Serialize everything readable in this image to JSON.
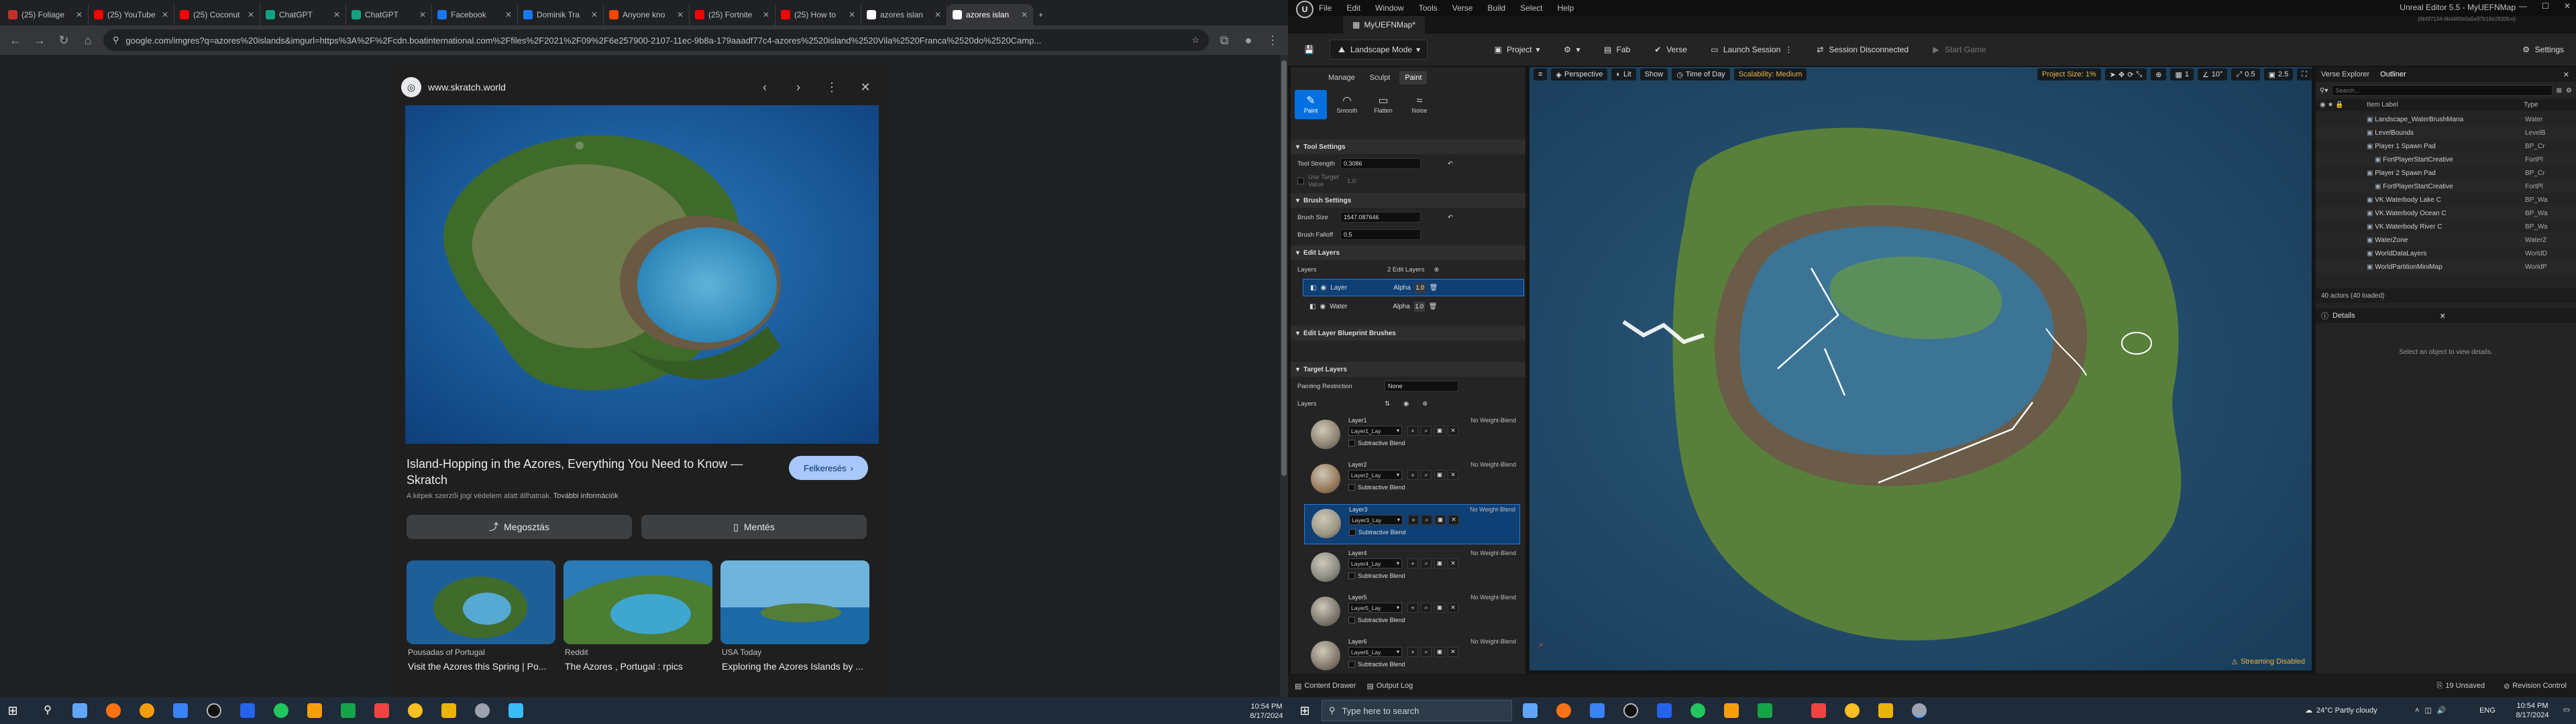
{
  "browser": {
    "tabs": [
      {
        "label": "(25) Foliage",
        "color": "#c4302b"
      },
      {
        "label": "(25) YouTube",
        "color": "#ff0000"
      },
      {
        "label": "(25) Coconut",
        "color": "#ff0000"
      },
      {
        "label": "ChatGPT",
        "color": "#10a37f"
      },
      {
        "label": "ChatGPT",
        "color": "#10a37f"
      },
      {
        "label": "Facebook",
        "color": "#1877f2"
      },
      {
        "label": "Dominik Tra",
        "color": "#1877f2"
      },
      {
        "label": "Anyone kno",
        "color": "#ff4500"
      },
      {
        "label": "(25) Fortnite",
        "color": "#ff0000"
      },
      {
        "label": "(25) How to",
        "color": "#ff0000"
      },
      {
        "label": "azores islan",
        "color": "#ffffff"
      },
      {
        "label": "azores islan",
        "color": "#ffffff"
      }
    ],
    "url": "google.com/imgres?q=azores%20islands&imgurl=https%3A%2F%2Fcdn.boatinternational.com%2Ffiles%2F2021%2F09%2F6e257900-2107-11ec-9b8a-179aaadf77c4-azores%2520island%2520Vila%2520Franca%2520do%2520Camp..."
  },
  "image_panel": {
    "site_name": "www.skratch.world",
    "title": "Island-Hopping in the Azores, Everything You Need to Know — Skratch",
    "search_btn": "Felkeresés",
    "copyright": "A képek szerzői jogi védelem alatt állhatnak.",
    "more_info": "További információk",
    "share_btn": "Megosztás",
    "save_btn": "Mentés",
    "thumbs": [
      {
        "source": "Pousadas of Portugal",
        "caption": "Visit the Azores this Spring | Po..."
      },
      {
        "source": "Reddit",
        "caption": "The Azores , Portugal : rpics"
      },
      {
        "source": "USA Today",
        "caption": "Exploring the Azores Islands by ..."
      }
    ]
  },
  "left_clock": {
    "time": "10:54 PM",
    "date": "8/17/2024"
  },
  "ue": {
    "menu": [
      "File",
      "Edit",
      "Window",
      "Tools",
      "Verse",
      "Build",
      "Select",
      "Help"
    ],
    "app_title": "Unreal Editor 5.5 - MyUEFNMap",
    "app_sub": "{6b5f7134-6b4480e0a5e97b16e2930fce}",
    "map_tab": "MyUEFNMap*",
    "toolbar": {
      "mode": "Landscape Mode",
      "project": "Project",
      "fab": "Fab",
      "verse": "Verse",
      "launch": "Launch Session",
      "session": "Session Disconnected",
      "start": "Start Game",
      "settings": "Settings"
    },
    "mode_tabs": [
      "Manage",
      "Sculpt",
      "Paint"
    ],
    "tools": [
      "Paint",
      "Smooth",
      "Flatten",
      "Noise"
    ],
    "tool_settings": {
      "header": "Tool Settings",
      "strength_label": "Tool Strength",
      "strength_value": "0.3086",
      "target_label": "Use Target Value",
      "target_value": "1.0"
    },
    "brush_settings": {
      "header": "Brush Settings",
      "size_label": "Brush Size",
      "size_value": "1547.087646",
      "falloff_label": "Brush Falloff",
      "falloff_value": "0.5"
    },
    "edit_layers": {
      "header": "Edit Layers",
      "layers_label": "Layers",
      "count": "2 Edit Layers",
      "rows": [
        {
          "name": "Layer",
          "blend": "Alpha",
          "alpha": "1.0"
        },
        {
          "name": "Water",
          "blend": "Alpha",
          "alpha": "1.0"
        }
      ]
    },
    "bp_brushes": "Edit Layer Blueprint Brushes",
    "target_layers": {
      "header": "Target Layers",
      "restriction_label": "Painting Restriction",
      "restriction_value": "None",
      "layers_label": "Layers"
    },
    "paint_layers": [
      {
        "name": "Layer1",
        "asset": "Layer1_Lay",
        "nw": "No Weight-Blend",
        "sub": "Subtractive Blend",
        "color": "#8c8271"
      },
      {
        "name": "Layer2",
        "asset": "Layer2_Lay",
        "nw": "No Weight-Blend",
        "sub": "Subtractive Blend",
        "color": "#96795a"
      },
      {
        "name": "Layer3",
        "asset": "Layer3_Lay",
        "nw": "No Weight-Blend",
        "sub": "Subtractive Blend",
        "color": "#9c9585"
      },
      {
        "name": "Layer4",
        "asset": "Layer4_Lay",
        "nw": "No Weight-Blend",
        "sub": "Subtractive Blend",
        "color": "#8a8a82"
      },
      {
        "name": "Layer5",
        "asset": "Layer5_Lay",
        "nw": "No Weight-Blend",
        "sub": "Subtractive Blend",
        "color": "#7c776e"
      },
      {
        "name": "Layer6",
        "asset": "Layer6_Lay",
        "nw": "No Weight-Blend",
        "sub": "Subtractive Blend",
        "color": "#837a6c"
      }
    ],
    "viewport": {
      "perspective": "Perspective",
      "lit": "Lit",
      "show": "Show",
      "time": "Time of Day",
      "scalability": "Scalability: Medium",
      "project_size": "Project Size: 1%",
      "grid": "1",
      "angle": "10°",
      "scale": "0.5",
      "cam": "2.5",
      "streaming": "Streaming Disabled"
    },
    "outliner": {
      "tabs": [
        "Verse Explorer",
        "Outliner"
      ],
      "search_placeholder": "Search...",
      "col_label": "Item Label",
      "col_type": "Type",
      "rows": [
        {
          "name": "Landscape_WaterBrushMana",
          "type": "Water",
          "indent": 0
        },
        {
          "name": "LevelBounds",
          "type": "LevelB",
          "indent": 0
        },
        {
          "name": "Player 1 Spawn Pad",
          "type": "BP_Cr",
          "indent": 0
        },
        {
          "name": "FortPlayerStartCreative",
          "type": "FortPl",
          "indent": 1
        },
        {
          "name": "Player 2 Spawn Pad",
          "type": "BP_Cr",
          "indent": 0
        },
        {
          "name": "FortPlayerStartCreative",
          "type": "FortPl",
          "indent": 1
        },
        {
          "name": "VK.Waterbody Lake C",
          "type": "BP_Wa",
          "indent": 0
        },
        {
          "name": "VK.Waterbody Ocean C",
          "type": "BP_Wa",
          "indent": 0
        },
        {
          "name": "VK.Waterbody River C",
          "type": "BP_Wa",
          "indent": 0
        },
        {
          "name": "WaterZone",
          "type": "WaterZ",
          "indent": 0
        },
        {
          "name": "WorldDataLayers",
          "type": "WorldD",
          "indent": 0
        },
        {
          "name": "WorldPartitionMiniMap",
          "type": "WorldP",
          "indent": 0
        }
      ],
      "count": "40 actors (40 loaded)"
    },
    "details": {
      "tab": "Details",
      "empty": "Select an object to view details."
    },
    "status": {
      "content_drawer": "Content Drawer",
      "output_log": "Output Log",
      "unsaved": "19 Unsaved",
      "revision": "Revision Control"
    }
  },
  "taskbar": {
    "search_placeholder": "Type here to search",
    "weather": "24°C  Partly cloudy",
    "lang": "ENG",
    "time": "10:54 PM",
    "date": "8/17/2024"
  }
}
